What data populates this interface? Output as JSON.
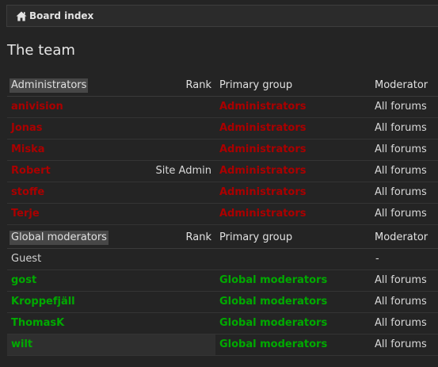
{
  "breadcrumb": {
    "label": "Board index"
  },
  "page": {
    "title": "The team"
  },
  "colors": {
    "administrators": "#aa0000",
    "global_moderators": "#00aa00"
  },
  "administrators": {
    "header": {
      "group": "Administrators",
      "rank": "Rank",
      "primary_group": "Primary group",
      "moderator": "Moderator"
    },
    "rows": [
      {
        "name": "anivision",
        "rank": "",
        "group": "Administrators",
        "moderator": "All forums"
      },
      {
        "name": "Jonas",
        "rank": "",
        "group": "Administrators",
        "moderator": "All forums"
      },
      {
        "name": "Miska",
        "rank": "",
        "group": "Administrators",
        "moderator": "All forums"
      },
      {
        "name": "Robert",
        "rank": "Site Admin",
        "group": "Administrators",
        "moderator": "All forums"
      },
      {
        "name": "stoffe",
        "rank": "",
        "group": "Administrators",
        "moderator": "All forums"
      },
      {
        "name": "Terje",
        "rank": "",
        "group": "Administrators",
        "moderator": "All forums"
      }
    ]
  },
  "global_moderators": {
    "header": {
      "group": "Global moderators",
      "rank": "Rank",
      "primary_group": "Primary group",
      "moderator": "Moderator"
    },
    "rows": [
      {
        "name": "Guest",
        "rank": "",
        "group": "",
        "moderator": "-"
      },
      {
        "name": "gost",
        "rank": "",
        "group": "Global moderators",
        "moderator": "All forums"
      },
      {
        "name": "Kroppefjäll",
        "rank": "",
        "group": "Global moderators",
        "moderator": "All forums"
      },
      {
        "name": "ThomasK",
        "rank": "",
        "group": "Global moderators",
        "moderator": "All forums"
      },
      {
        "name": "wilt",
        "rank": "",
        "group": "Global moderators",
        "moderator": "All forums"
      }
    ]
  }
}
